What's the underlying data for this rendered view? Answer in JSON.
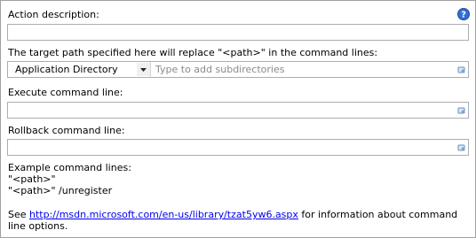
{
  "action_description": {
    "label": "Action description:",
    "value": "",
    "help_icon": "help-icon"
  },
  "target_path": {
    "label": "The target path specified here will replace \"<path>\" in the command lines:",
    "dropdown_value": "Application Directory",
    "subdir_placeholder": "Type to add subdirectories"
  },
  "execute": {
    "label": "Execute command line:",
    "value": ""
  },
  "rollback": {
    "label": "Rollback command line:",
    "value": ""
  },
  "examples": {
    "heading": "Example command lines:",
    "lines": [
      "\"<path>\"",
      "\"<path>\" /unregister"
    ]
  },
  "footer": {
    "prefix": "See ",
    "link_text": "http://msdn.microsoft.com/en-us/library/tzat5yw6.aspx",
    "suffix": " for information about command line options."
  },
  "colors": {
    "help_icon_fill": "#2f6fd1",
    "link": "#0000ee"
  }
}
